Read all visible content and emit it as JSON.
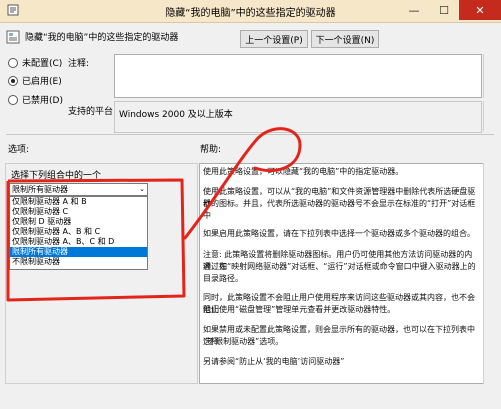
{
  "window": {
    "title": "隐藏“我的电脑”中的这些指定的驱动器",
    "minimize": "—",
    "maximize": "☐",
    "close": "✕"
  },
  "header": {
    "policy_name": "隐藏“我的电脑”中的这些指定的驱动器",
    "prev_button": "上一个设置(P)",
    "next_button": "下一个设置(N)"
  },
  "state": {
    "options": [
      {
        "label": "未配置(C)",
        "selected": false
      },
      {
        "label": "已启用(E)",
        "selected": true
      },
      {
        "label": "已禁用(D)",
        "selected": false
      }
    ]
  },
  "comment": {
    "label": "注释:",
    "value": ""
  },
  "support": {
    "label": "支持的平台:",
    "value": "Windows 2000 及以上版本"
  },
  "sections": {
    "options_label": "选项:",
    "help_label": "帮助:"
  },
  "options_panel": {
    "combo_label": "选择下列组合中的一个",
    "combo_value": "限制所有驱动器",
    "dropdown_items": [
      {
        "label": "仅限制驱动器 A 和 B",
        "selected": false
      },
      {
        "label": "仅限制驱动器 C",
        "selected": false
      },
      {
        "label": "仅限制 D 驱动器",
        "selected": false
      },
      {
        "label": "仅限制驱动器 A、B 和 C",
        "selected": false
      },
      {
        "label": "仅限制驱动器 A、B、C 和 D",
        "selected": false
      },
      {
        "label": "限制所有驱动器",
        "selected": true
      },
      {
        "label": "不限制驱动器",
        "selected": false
      }
    ]
  },
  "help": {
    "lines": [
      "使用此策略设置，可以隐藏“我的电脑”中的指定驱动器。",
      "",
      "使用此策略设置，可以从“我的电脑”和文件资源管理器中删除代表所选硬盘驱动",
      "器的图标。并且，代表所选驱动器的驱动器号不会显示在标准的“打开”对话框中",
      "",
      "如果启用此策略设置，请在下拉列表中选择一个驱动器或多个驱动器的组合。",
      "",
      "注意: 此策略设置将删除驱动器图标。用户仍可使用其他方法访问驱动器的内容，如",
      "通过在“映射网络驱动器”对话框、“运行”对话框或命令窗口中键入驱动器上的",
      "目录路径。",
      "",
      "同时，此策略设置不会阻止用户使用程序来访问这些驱动器或其内容，也不会阻止",
      "他们使用“磁盘管理”管理单元查看并更改驱动器特性。",
      "",
      "如果禁用或未配置此策略设置，则会显示所有的驱动器，也可以在下拉列表中选择",
      "“不限制驱动器”选项。",
      "",
      "另请参阅“防止从‘我的电脑’访问驱动器”"
    ]
  },
  "colors": {
    "titlebar": "#f7e7c9",
    "selection": "#0078d7",
    "annotation": "#e3241b",
    "close": "#c42b1c"
  }
}
